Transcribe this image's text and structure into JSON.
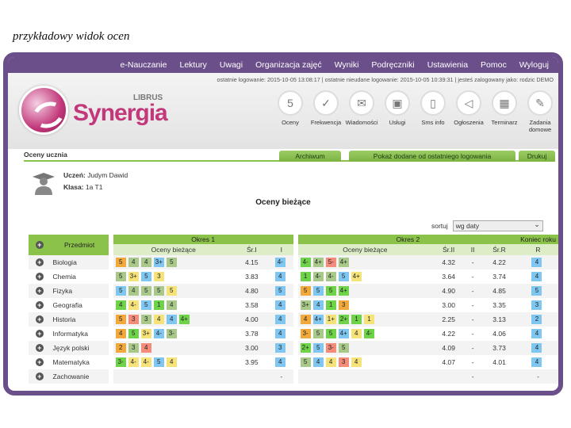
{
  "caption": "przykładowy widok ocen",
  "topnav": [
    "e-Nauczanie",
    "Lektury",
    "Uwagi",
    "Organizacja zajęć",
    "Wyniki",
    "Podręczniki",
    "Ustawienia",
    "Pomoc",
    "Wyloguj"
  ],
  "login_info": "ostatnie logowanie: 2015-10-05 13:08:17  |  ostatnie nieudane logowanie: 2015-10-05 10:39:31  |  jesteś zalogowany jako: rodzic DEMO",
  "logo": {
    "text": "Synergia",
    "brand": "LIBRUS"
  },
  "icons": [
    {
      "label": "Oceny",
      "icon": "grades-icon",
      "glyph": "5"
    },
    {
      "label": "Frekwencja",
      "icon": "attendance-icon",
      "glyph": "✓"
    },
    {
      "label": "Wiadomości",
      "icon": "messages-icon",
      "glyph": "✉"
    },
    {
      "label": "Usługi",
      "icon": "services-icon",
      "glyph": "▣"
    },
    {
      "label": "Sms info",
      "icon": "sms-icon",
      "glyph": "▯"
    },
    {
      "label": "Ogłoszenia",
      "icon": "announcements-icon",
      "glyph": "◁"
    },
    {
      "label": "Terminarz",
      "icon": "calendar-icon",
      "glyph": "▦"
    },
    {
      "label": "Zadania domowe",
      "icon": "homework-icon",
      "glyph": "✎"
    }
  ],
  "tabs": {
    "title": "Oceny ucznia",
    "archive": "Archiwum",
    "show_new": "Pokaż dodane od ostatniego logowania",
    "print": "Drukuj"
  },
  "student": {
    "name_label": "Uczeń:",
    "name": "Judym Dawid",
    "class_label": "Klasa:",
    "class": "1a T1"
  },
  "section_title": "Oceny bieżące",
  "sort": {
    "label": "sortuj",
    "value": "wg daty"
  },
  "table": {
    "subject_header": "Przedmiot",
    "term1": "Okres 1",
    "term2": "Okres 2",
    "year": "Koniec roku",
    "current_grades": "Oceny bieżące",
    "avg1": "Śr.I",
    "final1": "I",
    "avg2": "Śr.II",
    "final2": "II",
    "avgR": "Śr.R",
    "finalR": "R",
    "rows": [
      {
        "subject": "Biologia",
        "t1": [
          "5",
          "4",
          "4",
          "3+",
          "5"
        ],
        "avg1": "4.15",
        "f1": "4-",
        "t2": [
          "4-",
          "4+",
          "5-",
          "4+"
        ],
        "avg2": "4.32",
        "f2": "-",
        "avgR": "4.22",
        "fR": "4"
      },
      {
        "subject": "Chemia",
        "t1": [
          "5",
          "3+",
          "5",
          "3"
        ],
        "avg1": "3.83",
        "f1": "4",
        "t2": [
          "1",
          "4-",
          "4-",
          "5",
          "4+"
        ],
        "avg2": "3.64",
        "f2": "-",
        "avgR": "3.74",
        "fR": "4"
      },
      {
        "subject": "Fizyka",
        "t1": [
          "5",
          "4",
          "5",
          "5",
          "5"
        ],
        "avg1": "4.80",
        "f1": "5",
        "t2": [
          "5",
          "5",
          "5",
          "4+"
        ],
        "avg2": "4.90",
        "f2": "-",
        "avgR": "4.85",
        "fR": "5"
      },
      {
        "subject": "Geografia",
        "t1": [
          "4",
          "4-",
          "5",
          "1",
          "4"
        ],
        "avg1": "3.58",
        "f1": "4",
        "t2": [
          "3+",
          "4",
          "1",
          "3"
        ],
        "avg2": "3.00",
        "f2": "-",
        "avgR": "3.35",
        "fR": "3"
      },
      {
        "subject": "Historia",
        "t1": [
          "5",
          "3",
          "3",
          "4",
          "4",
          "4+"
        ],
        "avg1": "4.00",
        "f1": "4",
        "t2": [
          "4",
          "4+",
          "1+",
          "2+",
          "1",
          "1"
        ],
        "avg2": "2.25",
        "f2": "-",
        "avgR": "3.13",
        "fR": "2"
      },
      {
        "subject": "Informatyka",
        "t1": [
          "4",
          "5",
          "3+",
          "4-",
          "3-"
        ],
        "avg1": "3.78",
        "f1": "4",
        "t2": [
          "3-",
          "5",
          "5",
          "4+",
          "4",
          "4-"
        ],
        "avg2": "4.22",
        "f2": "-",
        "avgR": "4.06",
        "fR": "4"
      },
      {
        "subject": "Język polski",
        "t1": [
          "2",
          "3",
          "4"
        ],
        "avg1": "3.00",
        "f1": "3",
        "t2": [
          "2+",
          "5",
          "3-",
          "5"
        ],
        "avg2": "4.09",
        "f2": "-",
        "avgR": "3.73",
        "fR": "4"
      },
      {
        "subject": "Matematyka",
        "t1": [
          "3-",
          "4-",
          "4-",
          "5",
          "4"
        ],
        "avg1": "3.95",
        "f1": "4",
        "t2": [
          "5",
          "4",
          "4",
          "3",
          "4"
        ],
        "avg2": "4.07",
        "f2": "-",
        "avgR": "4.01",
        "fR": "4"
      },
      {
        "subject": "Zachowanie",
        "t1": [],
        "avg1": "",
        "f1": "-",
        "t2": [],
        "avg2": "",
        "f2": "-",
        "avgR": "",
        "fR": "-"
      }
    ]
  },
  "grade_colors": {
    "Biologia": {
      "t1": [
        "#f2a93b",
        "#a9c98b",
        "#a9c98b",
        "#7fc7f0",
        "#a9c98b"
      ],
      "t2": [
        "#6fd34a",
        "#a9c98b",
        "#f58b7a",
        "#a9c98b"
      ]
    },
    "Chemia": {
      "t1": [
        "#a9c98b",
        "#f5e37a",
        "#7fc7f0",
        "#f5e37a"
      ],
      "t2": [
        "#6fd34a",
        "#a9c98b",
        "#a9c98b",
        "#7fc7f0",
        "#f5e37a"
      ]
    },
    "Fizyka": {
      "t1": [
        "#7fc7f0",
        "#a9c98b",
        "#a9c98b",
        "#a9c98b",
        "#f5e37a"
      ],
      "t2": [
        "#f2a93b",
        "#7fc7f0",
        "#6fd34a",
        "#6fd34a"
      ]
    },
    "Geografia": {
      "t1": [
        "#6fd34a",
        "#f5e37a",
        "#7fc7f0",
        "#6fd34a",
        "#a9c98b"
      ],
      "t2": [
        "#a9c98b",
        "#7fc7f0",
        "#6fd34a",
        "#f2a93b"
      ]
    },
    "Historia": {
      "t1": [
        "#f2a93b",
        "#f58b7a",
        "#a9c98b",
        "#f5e37a",
        "#7fc7f0",
        "#6fd34a"
      ],
      "t2": [
        "#f2a93b",
        "#7fc7f0",
        "#f5e37a",
        "#6fd34a",
        "#6fd34a",
        "#f5e37a"
      ]
    },
    "Informatyka": {
      "t1": [
        "#f2a93b",
        "#6fd34a",
        "#f5e37a",
        "#7fc7f0",
        "#a9c98b"
      ],
      "t2": [
        "#f2a93b",
        "#a9c98b",
        "#6fd34a",
        "#7fc7f0",
        "#f5e37a",
        "#6fd34a"
      ]
    },
    "Język polski": {
      "t1": [
        "#f2a93b",
        "#a9c98b",
        "#f58b7a"
      ],
      "t2": [
        "#6fd34a",
        "#7fc7f0",
        "#f58b7a",
        "#a9c98b"
      ]
    },
    "Matematyka": {
      "t1": [
        "#6fd34a",
        "#f5e37a",
        "#f5e37a",
        "#7fc7f0",
        "#f5e37a"
      ],
      "t2": [
        "#a9c98b",
        "#7fc7f0",
        "#f5e37a",
        "#f58b7a",
        "#f5e37a"
      ]
    },
    "Zachowanie": {
      "t1": [],
      "t2": []
    }
  },
  "final_color": "#7fc7f0",
  "accent": "#6b4f8b",
  "green": "#8bc34a"
}
